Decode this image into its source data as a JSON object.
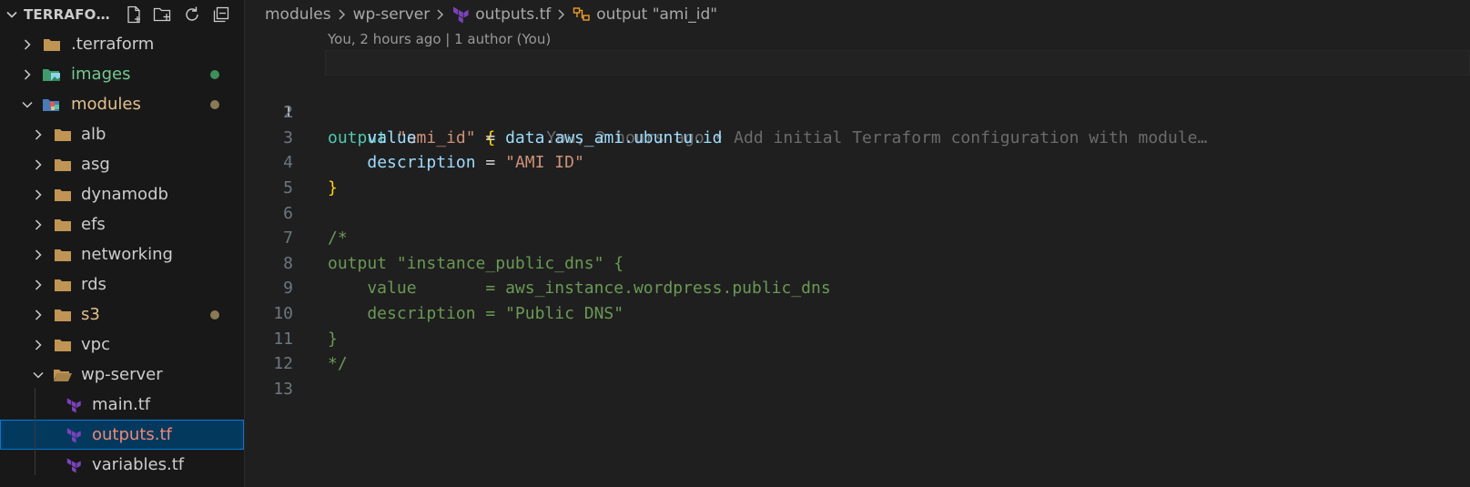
{
  "explorer": {
    "title": "TERRAFORM",
    "actions": [
      {
        "name": "new-file-icon"
      },
      {
        "name": "new-folder-icon"
      },
      {
        "name": "refresh-icon"
      },
      {
        "name": "collapse-all-icon"
      }
    ],
    "items": [
      {
        "label": ".terraform",
        "type": "folder",
        "expanded": false,
        "depth": 0,
        "color": "#cccccc"
      },
      {
        "label": "images",
        "type": "images-folder",
        "expanded": false,
        "depth": 0,
        "color": "#73c991",
        "dot": "#3e8f5a"
      },
      {
        "label": "modules",
        "type": "modules-folder",
        "expanded": true,
        "depth": 0,
        "color": "#e2c08d",
        "dot": "#8a7a55"
      },
      {
        "label": "alb",
        "type": "folder",
        "expanded": false,
        "depth": 1,
        "color": "#cccccc"
      },
      {
        "label": "asg",
        "type": "folder",
        "expanded": false,
        "depth": 1,
        "color": "#cccccc"
      },
      {
        "label": "dynamodb",
        "type": "folder",
        "expanded": false,
        "depth": 1,
        "color": "#cccccc"
      },
      {
        "label": "efs",
        "type": "folder",
        "expanded": false,
        "depth": 1,
        "color": "#cccccc"
      },
      {
        "label": "networking",
        "type": "folder",
        "expanded": false,
        "depth": 1,
        "color": "#cccccc"
      },
      {
        "label": "rds",
        "type": "folder",
        "expanded": false,
        "depth": 1,
        "color": "#cccccc"
      },
      {
        "label": "s3",
        "type": "folder",
        "expanded": false,
        "depth": 1,
        "color": "#e2c08d",
        "dot": "#8a7a55"
      },
      {
        "label": "vpc",
        "type": "folder",
        "expanded": false,
        "depth": 1,
        "color": "#cccccc"
      },
      {
        "label": "wp-server",
        "type": "folder-open",
        "expanded": true,
        "depth": 1,
        "color": "#cccccc"
      },
      {
        "label": "main.tf",
        "type": "terraform",
        "depth": 2,
        "color": "#cccccc"
      },
      {
        "label": "outputs.tf",
        "type": "terraform",
        "depth": 2,
        "color": "#f48771",
        "selected": true
      },
      {
        "label": "variables.tf",
        "type": "terraform",
        "depth": 2,
        "color": "#cccccc"
      }
    ]
  },
  "breadcrumb": {
    "parts": [
      "modules",
      "wp-server",
      "outputs.tf",
      "output \"ami_id\""
    ]
  },
  "codelens": "You, 2 hours ago | 1 author (You)",
  "blame": "You, 2 hours ago • Add initial Terraform configuration with module…",
  "colors": {
    "accent": "#0078d4",
    "selection": "#04395e",
    "terraform": "#7b42bc",
    "folder": "#c09553"
  },
  "code": {
    "line_numbers": [
      "1",
      "2",
      "3",
      "4",
      "5",
      "6",
      "7",
      "8",
      "9",
      "10",
      "11",
      "12",
      "13"
    ],
    "l1": {
      "kw": "output",
      "str": "\"ami_id\"",
      "brace": "{"
    },
    "l2": {
      "key": "value",
      "eq": "=",
      "val": "data.aws_ami.ubuntu.id"
    },
    "l3": {
      "key": "description",
      "eq": "=",
      "str": "\"AMI ID\""
    },
    "l4": {
      "brace": "}"
    },
    "l6": "/*",
    "l7": "output \"instance_public_dns\" {",
    "l8": "    value       = aws_instance.wordpress.public_dns",
    "l9": "    description = \"Public DNS\"",
    "l10": "}",
    "l11": "*/"
  }
}
